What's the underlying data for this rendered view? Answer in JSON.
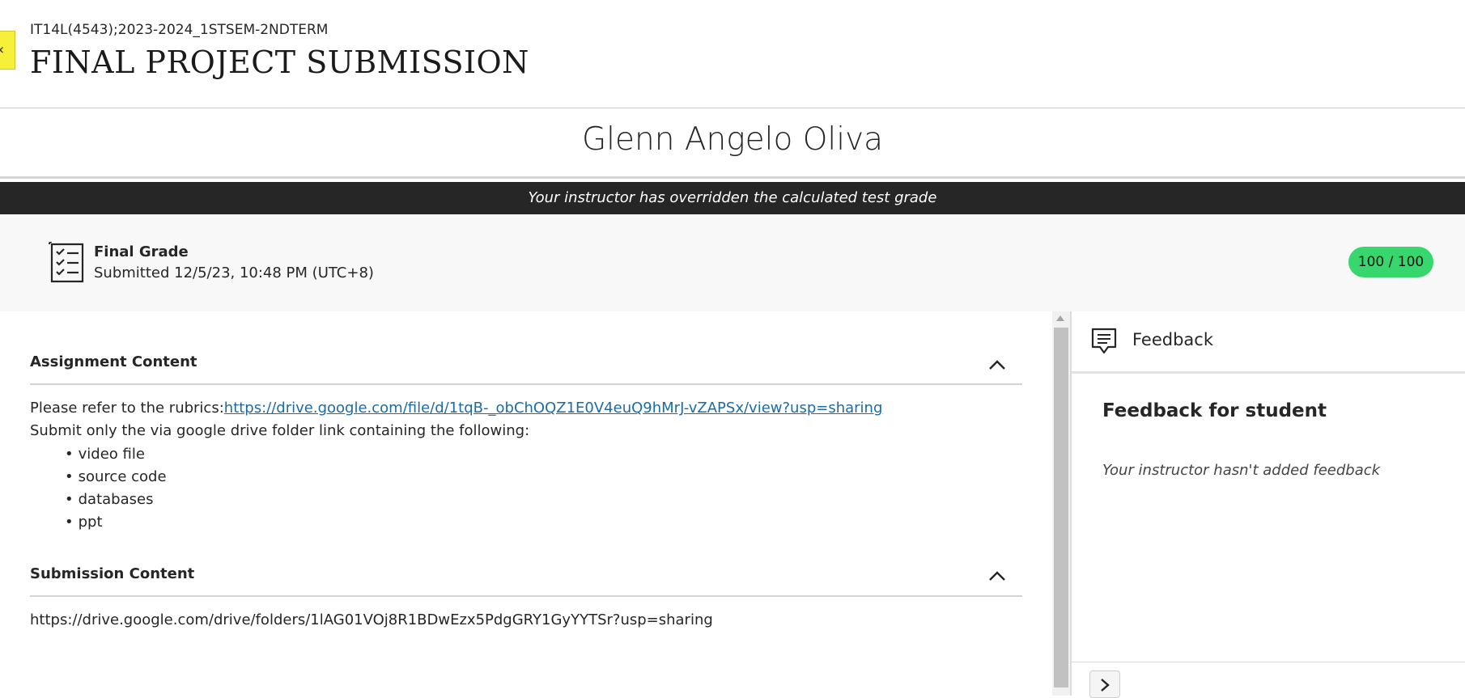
{
  "header": {
    "back_arrow": "‹",
    "course_code": "IT14L(4543);2023-2024_1STSEM-2NDTERM",
    "title": "FINAL PROJECT SUBMISSION"
  },
  "student": {
    "name": "Glenn Angelo Oliva"
  },
  "banner": {
    "text": "Your instructor has overridden the calculated test grade"
  },
  "grade": {
    "icon": "checklist-icon",
    "label": "Final Grade",
    "submitted": "Submitted 12/5/23, 10:48 PM (UTC+8)",
    "score": "100 / 100",
    "score_color": "#37d76e"
  },
  "assignment": {
    "title": "Assignment Content",
    "rubric_prefix": "Please refer to the rubrics:",
    "rubric_link": "https://drive.google.com/file/d/1tqB-_obChOQZ1E0V4euQ9hMrJ-vZAPSx/view?usp=sharing",
    "instruction": "Submit only the via google drive folder link containing the following:",
    "items": [
      "video file",
      "source code",
      "databases",
      "ppt"
    ]
  },
  "submission": {
    "title": "Submission Content",
    "link": "https://drive.google.com/drive/folders/1lAG01VOj8R1BDwEzx5PdgGRY1GyYYTSr?usp=sharing"
  },
  "feedback": {
    "icon": "comment-icon",
    "title": "Feedback",
    "heading": "Feedback for student",
    "empty_text": "Your instructor hasn't added feedback"
  },
  "colors": {
    "link": "#1d6ba6",
    "banner_bg": "#262626",
    "back_tab": "#f6f03a"
  }
}
